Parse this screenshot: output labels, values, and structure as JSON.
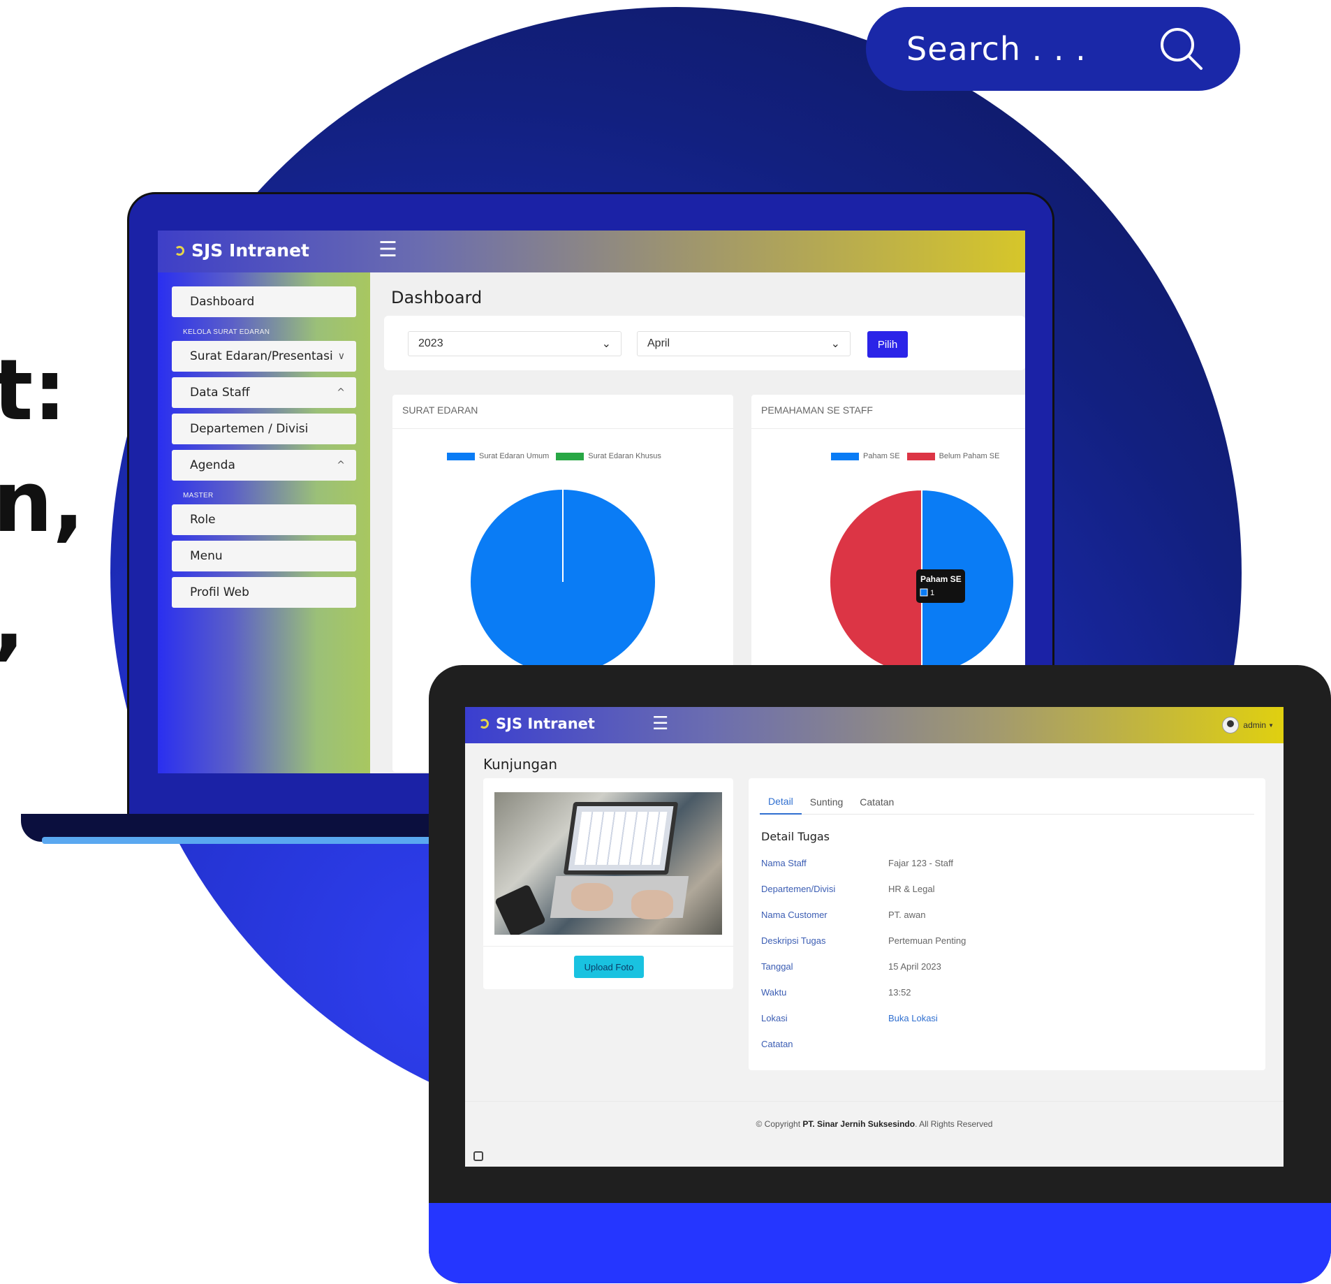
{
  "hero_text": {
    "line1": "t:",
    "line2": "n,",
    "line3": ","
  },
  "search": {
    "placeholder": "Search . . .",
    "icon": "search-icon"
  },
  "dashboard_screen": {
    "brand": "SJS Intranet",
    "page_title": "Dashboard",
    "sidebar": {
      "section_kelola": "KELOLA SURAT EDARAN",
      "section_master": "MASTER",
      "items": [
        {
          "label": "Dashboard"
        },
        {
          "label": "Surat Edaran/Presentasi",
          "chevron": "∨"
        },
        {
          "label": "Data Staff",
          "chevron": "^"
        },
        {
          "label": "Departemen / Divisi"
        },
        {
          "label": "Agenda",
          "chevron": "^"
        },
        {
          "label": "Role"
        },
        {
          "label": "Menu"
        },
        {
          "label": "Profil Web"
        }
      ]
    },
    "filters": {
      "year": "2023",
      "month": "April",
      "submit_label": "Pilih"
    },
    "colors": {
      "blue": "#0a7cf5",
      "green": "#28a745",
      "red": "#dc3545"
    }
  },
  "chart_data": [
    {
      "type": "pie",
      "title": "SURAT EDARAN",
      "categories": [
        "Surat Edaran Umum",
        "Surat Edaran Khusus"
      ],
      "values": [
        1,
        0
      ],
      "legend": "top"
    },
    {
      "type": "pie",
      "title": "PEMAHAMAN SE STAFF",
      "categories": [
        "Paham SE",
        "Belum Paham SE"
      ],
      "values": [
        1,
        1
      ],
      "legend": "top",
      "tooltip": {
        "label": "Paham SE",
        "value": "1"
      }
    }
  ],
  "kunjungan_screen": {
    "brand": "SJS Intranet",
    "user": "admin",
    "page_title": "Kunjungan",
    "upload_label": "Upload Foto",
    "tabs": [
      "Detail",
      "Sunting",
      "Catatan"
    ],
    "detail_title": "Detail Tugas",
    "details": [
      {
        "label": "Nama Staff",
        "value": "Fajar 123 - Staff"
      },
      {
        "label": "Departemen/Divisi",
        "value": "HR & Legal"
      },
      {
        "label": "Nama Customer",
        "value": "PT. awan"
      },
      {
        "label": "Deskripsi Tugas",
        "value": "Pertemuan Penting"
      },
      {
        "label": "Tanggal",
        "value": "15 April 2023"
      },
      {
        "label": "Waktu",
        "value": "13:52"
      },
      {
        "label": "Lokasi",
        "value": "Buka Lokasi"
      },
      {
        "label": "Catatan",
        "value": ""
      }
    ],
    "footer": {
      "prefix": "© Copyright ",
      "company": "PT. Sinar Jernih Suksesindo",
      "suffix": ". All Rights Reserved"
    }
  }
}
